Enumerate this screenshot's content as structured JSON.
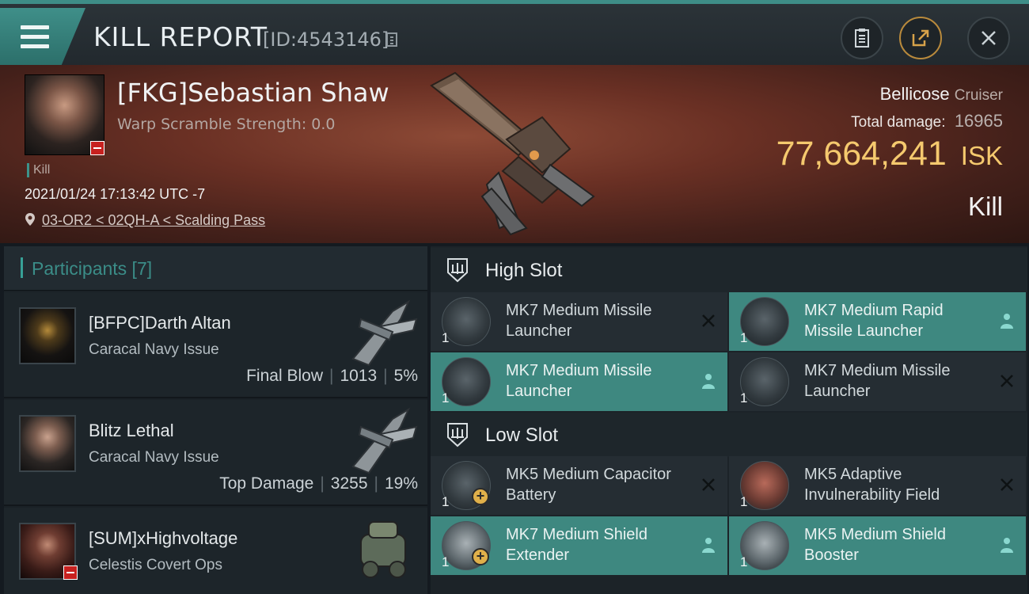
{
  "header": {
    "title": "KILL REPORT",
    "report_id": "[ID:4543146]"
  },
  "victim": {
    "name": "[FKG]Sebastian Shaw",
    "warp_scramble": "Warp Scramble Strength: 0.0",
    "tag": "Kill",
    "datetime": "2021/01/24 17:13:42 UTC -7",
    "location": "03-OR2 < 02QH-A < Scalding Pass",
    "ship_name": "Bellicose",
    "ship_class": "Cruiser",
    "total_damage_label": "Total damage:",
    "total_damage": "16965",
    "isk_value": "77,664,241",
    "isk_unit": "ISK",
    "result": "Kill"
  },
  "participants": {
    "header": "Participants [7]",
    "rows": [
      {
        "name": "[BFPC]Darth Altan",
        "ship": "Caracal Navy Issue",
        "label": "Final Blow",
        "damage": "1013",
        "percent": "5%"
      },
      {
        "name": "Blitz Lethal",
        "ship": "Caracal Navy Issue",
        "label": "Top Damage",
        "damage": "3255",
        "percent": "19%"
      },
      {
        "name": "[SUM]xHighvoltage",
        "ship": "Celestis Covert Ops",
        "label": "",
        "damage": "",
        "percent": ""
      }
    ]
  },
  "slots": {
    "high": {
      "title": "High Slot",
      "modules": [
        {
          "name": "MK7 Medium Missile Launcher",
          "qty": "1",
          "status": "destroyed"
        },
        {
          "name": "MK7 Medium Rapid Missile Launcher",
          "qty": "1",
          "status": "dropped"
        },
        {
          "name": "MK7 Medium Missile Launcher",
          "qty": "1",
          "status": "dropped"
        },
        {
          "name": "MK7 Medium Missile Launcher",
          "qty": "1",
          "status": "destroyed"
        }
      ]
    },
    "low": {
      "title": "Low Slot",
      "modules": [
        {
          "name": "MK5 Medium Capacitor Battery",
          "qty": "1",
          "status": "destroyed"
        },
        {
          "name": "MK5 Adaptive Invulnerability Field",
          "qty": "1",
          "status": "destroyed"
        },
        {
          "name": "MK7 Medium Shield Extender",
          "qty": "1",
          "status": "dropped"
        },
        {
          "name": "MK5 Medium Shield Booster",
          "qty": "1",
          "status": "dropped"
        }
      ]
    }
  },
  "colors": {
    "accent": "#3e8880",
    "isk": "#f5c96e",
    "badge_red": "#c7211f"
  },
  "icons": {
    "menu": "hamburger-menu-icon",
    "copy": "copy-icon",
    "clipboard": "clipboard-icon",
    "share": "share-icon",
    "close": "close-icon",
    "location": "location-pin-icon",
    "destroyed": "x-icon",
    "dropped": "person-icon",
    "slot": "slot-icon"
  }
}
